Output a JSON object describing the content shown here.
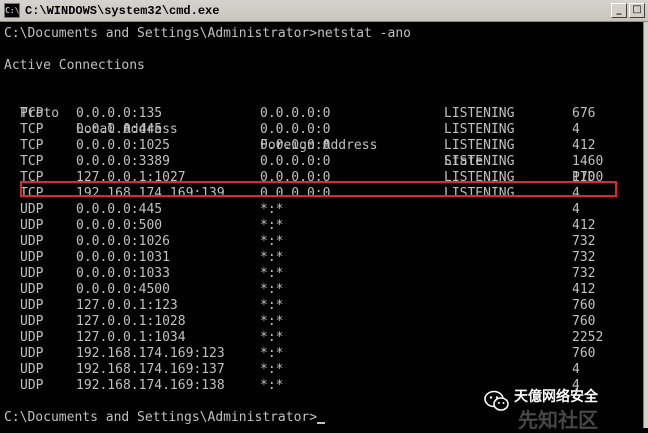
{
  "window": {
    "title": "C:\\WINDOWS\\system32\\cmd.exe",
    "icon": "cmd-icon",
    "minimize_label": "_",
    "maximize_label": "□"
  },
  "console": {
    "command_line": "C:\\Documents and Settings\\Administrator>netstat -ano",
    "section_title": "Active Connections",
    "headers": [
      "Proto",
      "Local Address",
      "Foreign Address",
      "State",
      "PID"
    ],
    "rows": [
      [
        "TCP",
        "0.0.0.0:135",
        "0.0.0.0:0",
        "LISTENING",
        "676"
      ],
      [
        "TCP",
        "0.0.0.0:445",
        "0.0.0.0:0",
        "LISTENING",
        "4"
      ],
      [
        "TCP",
        "0.0.0.0:1025",
        "0.0.0.0:0",
        "LISTENING",
        "412"
      ],
      [
        "TCP",
        "0.0.0.0:3389",
        "0.0.0.0:0",
        "LISTENING",
        "1460"
      ],
      [
        "TCP",
        "127.0.0.1:1027",
        "0.0.0.0:0",
        "LISTENING",
        "1700"
      ],
      [
        "TCP",
        "192.168.174.169:139",
        "0.0.0.0:0",
        "LISTENING",
        "4"
      ],
      [
        "UDP",
        "0.0.0.0:445",
        "*:*",
        "",
        "4"
      ],
      [
        "UDP",
        "0.0.0.0:500",
        "*:*",
        "",
        "412"
      ],
      [
        "UDP",
        "0.0.0.0:1026",
        "*:*",
        "",
        "732"
      ],
      [
        "UDP",
        "0.0.0.0:1031",
        "*:*",
        "",
        "732"
      ],
      [
        "UDP",
        "0.0.0.0:1033",
        "*:*",
        "",
        "732"
      ],
      [
        "UDP",
        "0.0.0.0:4500",
        "*:*",
        "",
        "412"
      ],
      [
        "UDP",
        "127.0.0.1:123",
        "*:*",
        "",
        "760"
      ],
      [
        "UDP",
        "127.0.0.1:1028",
        "*:*",
        "",
        "760"
      ],
      [
        "UDP",
        "127.0.0.1:1034",
        "*:*",
        "",
        "2252"
      ],
      [
        "UDP",
        "192.168.174.169:123",
        "*:*",
        "",
        "760"
      ],
      [
        "UDP",
        "192.168.174.169:137",
        "*:*",
        "",
        "4"
      ],
      [
        "UDP",
        "192.168.174.169:138",
        "*:*",
        "",
        "4"
      ]
    ],
    "highlighted_row": 3,
    "highlight_color": "#e3262b",
    "prompt": "C:\\Documents and Settings\\Administrator>"
  },
  "watermark": {
    "text": "天億网络安全",
    "ghost_text": "先知社区",
    "icon": "wechat-icon"
  },
  "colors": {
    "console_bg": "#000000",
    "console_fg": "#c0c0c0",
    "titlebar_bg": "#d4d0c8"
  }
}
